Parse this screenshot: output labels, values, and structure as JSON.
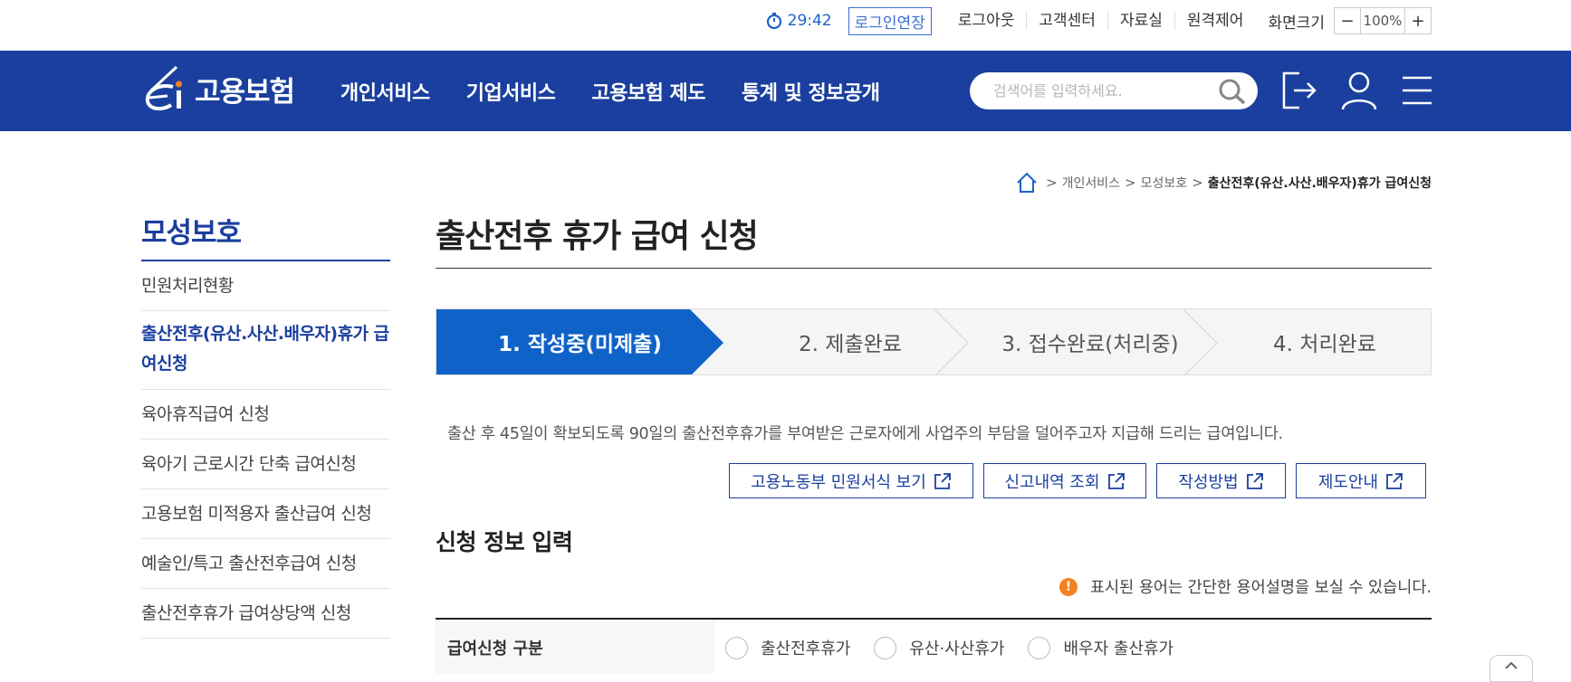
{
  "topbar": {
    "timer": "29:42",
    "extend_login": "로그인연장",
    "links": [
      "로그아웃",
      "고객센터",
      "자료실",
      "원격제어"
    ],
    "zoom_label": "화면크기",
    "zoom_minus": "−",
    "zoom_value": "100%",
    "zoom_plus": "+"
  },
  "nav": {
    "logo_text": "고용보험",
    "menu": [
      "개인서비스",
      "기업서비스",
      "고용보험 제도",
      "통계 및 정보공개"
    ],
    "search_placeholder": "검색어를 입력하세요."
  },
  "breadcrumb": {
    "items": [
      "개인서비스",
      "모성보호"
    ],
    "current": "출산전후(유산.사산.배우자)휴가 급여신청"
  },
  "sidebar": {
    "title": "모성보호",
    "items": [
      "민원처리현황",
      "출산전후(유산.사산.배우자)휴가 급여신청",
      "육아휴직급여 신청",
      "육아기 근로시간 단축 급여신청",
      "고용보험 미적용자 출산급여 신청",
      "예술인/특고 출산전후급여 신청",
      "출산전후휴가 급여상당액 신청"
    ],
    "active_index": 1
  },
  "main": {
    "title": "출산전후 휴가 급여 신청",
    "steps": [
      "1. 작성중(미제출)",
      "2. 제출완료",
      "3. 접수완료(처리중)",
      "4. 처리완료"
    ],
    "active_step": 0,
    "description": "출산 후 45일이 확보되도록 90일의 출산전후휴가를 부여받은 근로자에게 사업주의 부담을 덜어주고자 지급해 드리는 급여입니다.",
    "buttons": [
      "고용노동부 민원서식 보기",
      "신고내역 조회",
      "작성방법",
      "제도안내"
    ],
    "section_title": "신청 정보 입력",
    "notice": "표시된 용어는 간단한 용어설명을 보실 수 있습니다.",
    "notice_icon": "!",
    "form": {
      "label": "급여신청 구분",
      "options": [
        "출산전후휴가",
        "유산·사산휴가",
        "배우자 출산휴가"
      ]
    }
  },
  "colors": {
    "brand_blue": "#1a3f9e",
    "step_active": "#0f62c8",
    "notice_orange": "#f58220"
  }
}
